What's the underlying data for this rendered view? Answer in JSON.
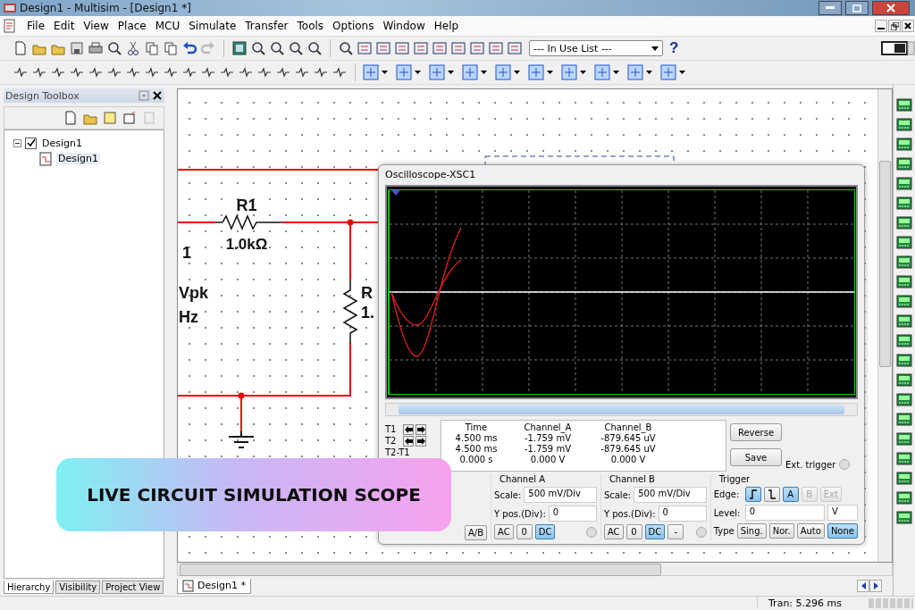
{
  "window": {
    "title": "Design1 - Multisim - [Design1 *]"
  },
  "menu": [
    {
      "label": "File"
    },
    {
      "label": "Edit"
    },
    {
      "label": "View"
    },
    {
      "label": "Place"
    },
    {
      "label": "MCU"
    },
    {
      "label": "Simulate"
    },
    {
      "label": "Transfer"
    },
    {
      "label": "Tools"
    },
    {
      "label": "Options"
    },
    {
      "label": "Window"
    },
    {
      "label": "Help"
    }
  ],
  "toolbar": {
    "component_list": {
      "value": "--- In Use List ---"
    },
    "help": "?"
  },
  "design_toolbox": {
    "title": "Design Toolbox",
    "tree": [
      {
        "label": "Design1",
        "checked": true,
        "expanded": true,
        "children": [
          {
            "label": "Design1",
            "selected": true
          }
        ]
      }
    ],
    "tabs": [
      {
        "label": "Hierarchy",
        "selected": true
      },
      {
        "label": "Visibility",
        "selected": false
      },
      {
        "label": "Project View",
        "selected": false
      }
    ]
  },
  "schematic": {
    "labels": [
      {
        "text": "R1"
      },
      {
        "text": "1.0kΩ"
      },
      {
        "text": "1"
      },
      {
        "text": "Vpk"
      },
      {
        "text": "Hz"
      },
      {
        "text": "R"
      },
      {
        "text": "1."
      }
    ]
  },
  "oscilloscope": {
    "title": "Oscilloscope-XSC1",
    "readout": {
      "columns": [
        "Time",
        "Channel_A",
        "Channel_B"
      ],
      "rows": [
        {
          "label": "T1",
          "cursor_buttons": true,
          "values": [
            "4.500 ms",
            "-1.759 mV",
            "-879.645 uV"
          ]
        },
        {
          "label": "T2",
          "cursor_buttons": true,
          "values": [
            "4.500 ms",
            "-1.759 mV",
            "-879.645 uV"
          ]
        },
        {
          "label": "T2-T1",
          "cursor_buttons": false,
          "values": [
            "0.000 s",
            "0.000 V",
            "0.000 V"
          ]
        }
      ]
    },
    "buttons": [
      "Reverse",
      "Save"
    ],
    "ext_trigger": "Ext. trigger",
    "timebase": {
      "buttons": [
        {
          "label": "A/B",
          "selected": false
        }
      ]
    },
    "channels": [
      {
        "title": "Channel A",
        "scale_label": "Scale:",
        "scale": "500 mV/Div",
        "ypos_label": "Y pos.(Div):",
        "ypos": "0",
        "coupling": [
          {
            "label": "AC",
            "selected": false
          },
          {
            "label": "0",
            "selected": false
          },
          {
            "label": "DC",
            "selected": true
          }
        ]
      },
      {
        "title": "Channel B",
        "scale_label": "Scale:",
        "scale": "500 mV/Div",
        "ypos_label": "Y pos.(Div):",
        "ypos": "0",
        "coupling": [
          {
            "label": "AC",
            "selected": false
          },
          {
            "label": "0",
            "selected": false
          },
          {
            "label": "DC",
            "selected": true
          },
          {
            "label": "-",
            "selected": false
          }
        ]
      }
    ],
    "trigger": {
      "title": "Trigger",
      "edge_label": "Edge:",
      "edges": [
        {
          "kind": "rising",
          "selected": true
        },
        {
          "kind": "falling",
          "selected": false
        }
      ],
      "sources": [
        {
          "label": "A",
          "selected": true,
          "disabled": false
        },
        {
          "label": "B",
          "selected": false,
          "disabled": true
        },
        {
          "label": "Ext",
          "selected": false,
          "disabled": true
        }
      ],
      "level_label": "Level:",
      "level": "0",
      "unit": "V",
      "type_label": "Type",
      "types": [
        {
          "label": "Sing.",
          "selected": false
        },
        {
          "label": "Nor.",
          "selected": false
        },
        {
          "label": "Auto",
          "selected": false
        },
        {
          "label": "None",
          "selected": true
        }
      ]
    }
  },
  "doc_tabs": [
    {
      "label": "Design1 *",
      "selected": true
    }
  ],
  "status_bar": {
    "simulation": "Tran: 5.296 ms"
  },
  "banner": {
    "text": "LIVE CIRCUIT SIMULATION SCOPE"
  }
}
